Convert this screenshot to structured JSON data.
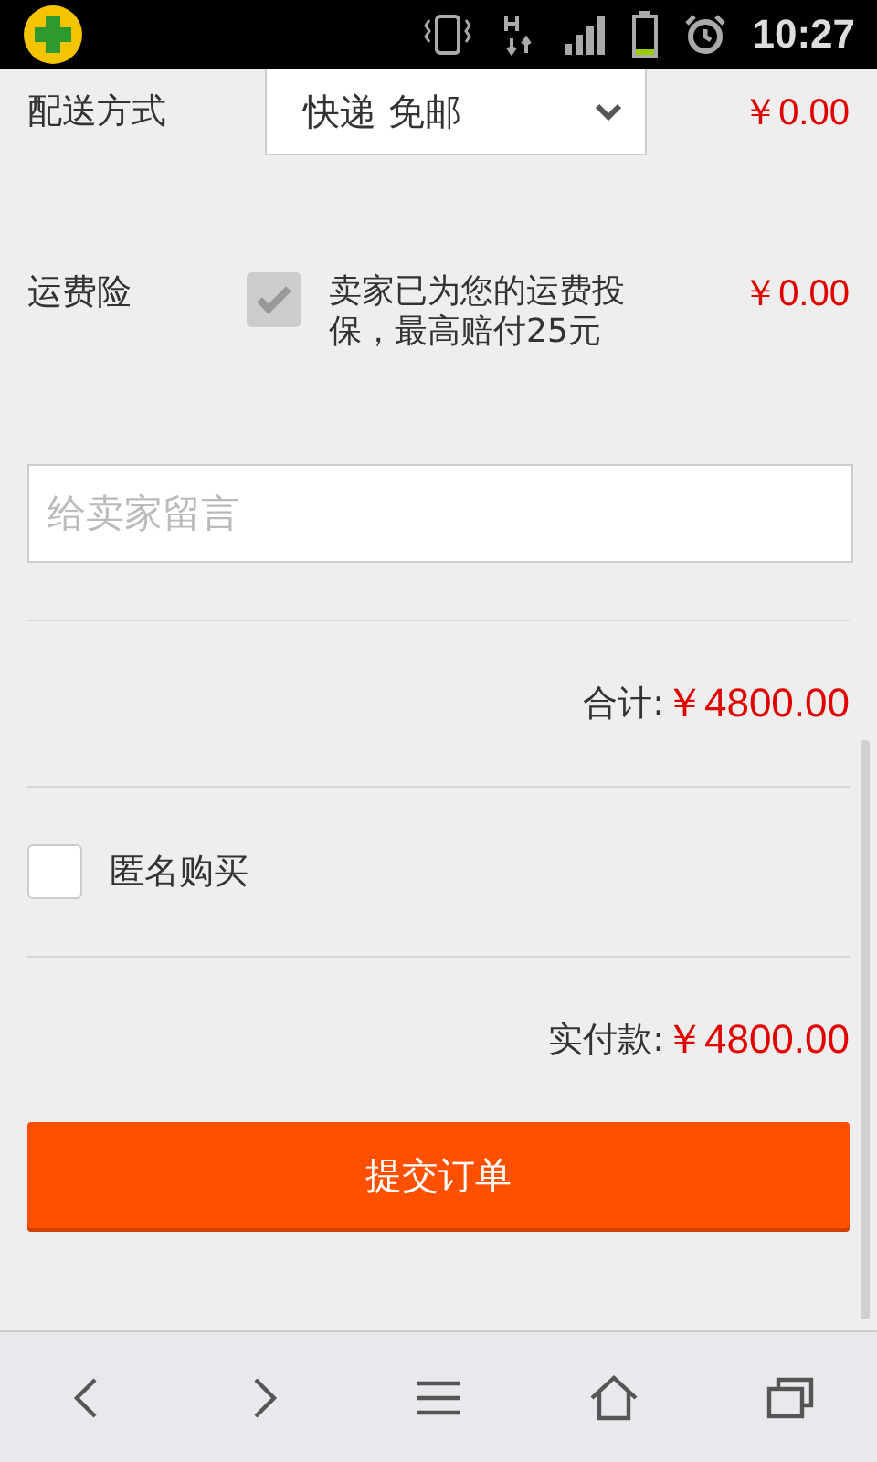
{
  "status_bar": {
    "time": "10:27"
  },
  "delivery": {
    "label": "配送方式",
    "value": "快递 免邮",
    "price": "￥0.00"
  },
  "insurance": {
    "label": "运费险",
    "checked": true,
    "disabled": true,
    "note": "卖家已为您的运费投保，最高赔付25元",
    "price": "￥0.00"
  },
  "message": {
    "placeholder": "给卖家留言"
  },
  "subtotal": {
    "label": "合计:",
    "amount": "￥4800.00"
  },
  "anonymous": {
    "label": "匿名购买",
    "checked": false
  },
  "total": {
    "label": "实付款:",
    "amount": "￥4800.00"
  },
  "submit": {
    "label": "提交订单"
  }
}
